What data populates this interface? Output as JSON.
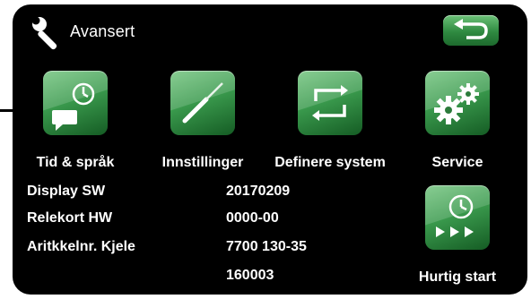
{
  "header": {
    "title": "Avansert",
    "icon": "wrench-icon",
    "back_icon": "return-arrow-icon"
  },
  "tiles": [
    {
      "label": "Tid & språk",
      "icon": "clock-speech-icon"
    },
    {
      "label": "Innstillinger",
      "icon": "screwdriver-icon"
    },
    {
      "label": "Definere system",
      "icon": "cycle-arrows-icon"
    },
    {
      "label": "Service",
      "icon": "gears-icon"
    }
  ],
  "info": [
    {
      "label": "Display SW",
      "value": "20170209"
    },
    {
      "label": "Relekort HW",
      "value": "0000-00"
    },
    {
      "label": "Aritkkelnr. Kjele",
      "value": "7700 130-35"
    },
    {
      "label": "",
      "value": "160003"
    }
  ],
  "quick_start": {
    "label": "Hurtig start",
    "icon": "clock-fastforward-icon"
  },
  "colors": {
    "background": "#000000",
    "tile_green": "#3a9a4d",
    "text": "#ffffff"
  }
}
